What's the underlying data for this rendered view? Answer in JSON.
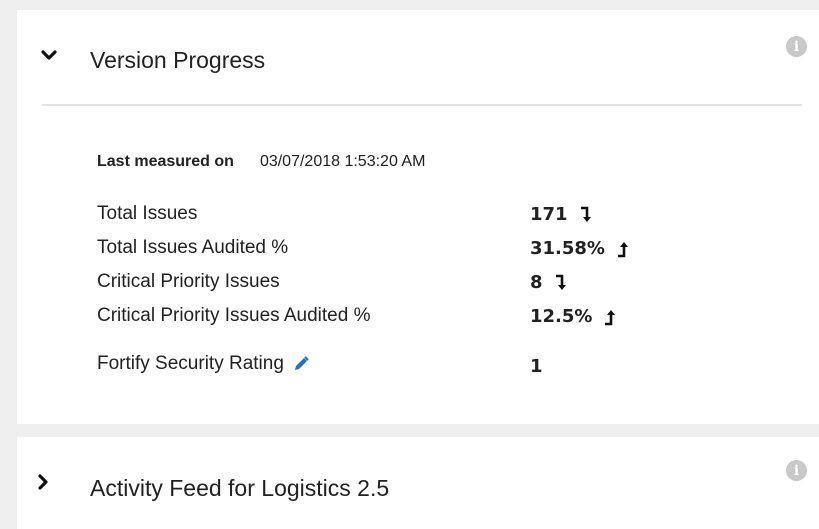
{
  "version_progress": {
    "title": "Version Progress",
    "info_icon": "info-icon",
    "last_measured_label": "Last measured on",
    "last_measured_value": "03/07/2018 1:53:20 AM",
    "metrics": [
      {
        "label": "Total Issues",
        "value": "171",
        "trend": "down"
      },
      {
        "label": "Total Issues Audited %",
        "value": "31.58%",
        "trend": "up"
      },
      {
        "label": "Critical Priority Issues",
        "value": "8",
        "trend": "down"
      },
      {
        "label": "Critical Priority Issues Audited %",
        "value": "12.5%",
        "trend": "up"
      }
    ],
    "rating": {
      "label": "Fortify Security Rating",
      "value": "1",
      "edit_icon": "pencil-icon"
    }
  },
  "activity_feed": {
    "title": "Activity Feed for Logistics 2.5",
    "info_icon": "info-icon"
  },
  "colors": {
    "accent": "#1f6fd6",
    "info": "#c8c8c8",
    "divider": "#e2e2e2"
  }
}
